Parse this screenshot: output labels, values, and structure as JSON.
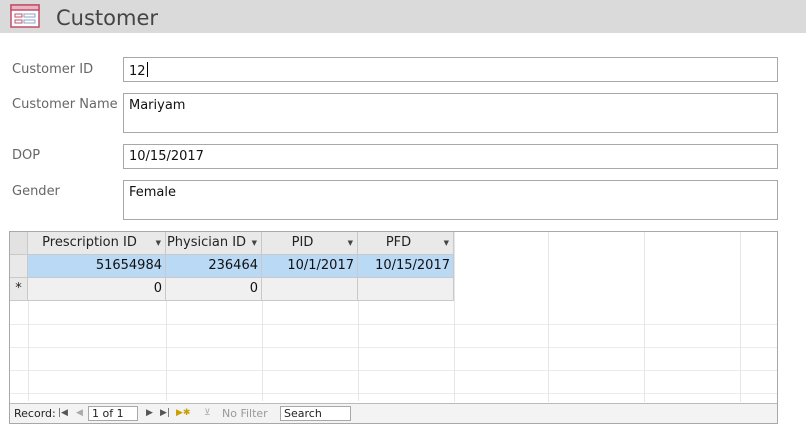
{
  "form": {
    "title": "Customer"
  },
  "fields": {
    "customer_id": {
      "label": "Customer ID",
      "value": "12"
    },
    "customer_name": {
      "label": "Customer Name",
      "value": "Mariyam"
    },
    "dop": {
      "label": "DOP",
      "value": "10/15/2017"
    },
    "gender": {
      "label": "Gender",
      "value": "Female"
    }
  },
  "subform": {
    "columns": [
      "Prescription ID",
      "Physician ID",
      "PID",
      "PFD"
    ],
    "rows": [
      [
        "51654984",
        "236464",
        "10/1/2017",
        "10/15/2017"
      ]
    ],
    "new_row": [
      "0",
      "0",
      "",
      ""
    ],
    "new_row_marker": "*"
  },
  "navigation": {
    "record_label": "Record:",
    "record_position": "1 of 1",
    "filter_label": "No Filter",
    "search_placeholder": "Search"
  },
  "icons": {
    "form": "form-icon",
    "first": "first-record-icon",
    "prev": "previous-record-icon",
    "next": "next-record-icon",
    "last": "last-record-icon",
    "new": "new-record-icon",
    "filter": "filter-icon",
    "sort": "dropdown-arrow-icon"
  },
  "colors": {
    "header_bg": "#dadada",
    "selected_row": "#b9d9f5",
    "icon_accent": "#c0506a"
  }
}
